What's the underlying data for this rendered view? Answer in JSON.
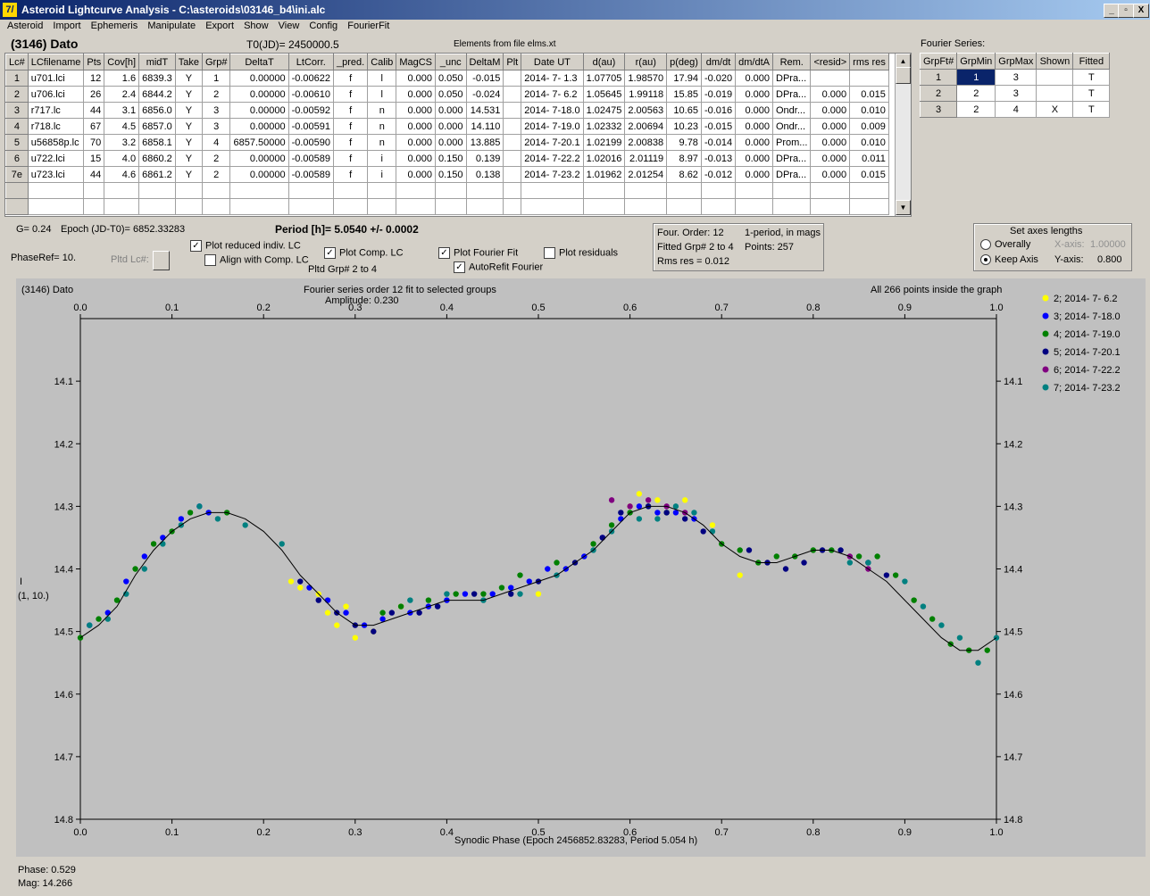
{
  "window": {
    "title": "Asteroid Lightcurve Analysis - C:\\asteroids\\03146_b4\\ini.alc",
    "icon_label": "7/",
    "btn_minimize": "_",
    "btn_restore": "▫",
    "btn_close": "X"
  },
  "menu": [
    "Asteroid",
    "Import",
    "Ephemeris",
    "Manipulate",
    "Export",
    "Show",
    "View",
    "Config",
    "FourierFit"
  ],
  "header": {
    "asteroid": "(3146) Dato",
    "t0": "T0(JD)= 2450000.5",
    "elements": "Elements from file elms.xt"
  },
  "lc_table": {
    "columns": [
      "Lc#",
      "LCfilename",
      "Pts",
      "Cov[h]",
      "midT",
      "Take",
      "Grp#",
      "DeltaT",
      "LtCorr.",
      "_pred.",
      "Calib",
      "MagCS",
      "_unc",
      "DeltaM",
      "Plt",
      "Date UT",
      "d(au)",
      "r(au)",
      "p(deg)",
      "dm/dt",
      "dm/dtA",
      "Rem.",
      "<resid>",
      "rms res"
    ],
    "rows": [
      [
        "1",
        "u701.lci",
        "12",
        "1.6",
        "6839.3",
        "Y",
        "1",
        "0.00000",
        "-0.00622",
        "f",
        "l",
        "0.000",
        "0.050",
        "-0.015",
        "",
        "2014- 7- 1.3",
        "1.07705",
        "1.98570",
        "17.94",
        "-0.020",
        "0.000",
        "DPra...",
        "",
        ""
      ],
      [
        "2",
        "u706.lci",
        "26",
        "2.4",
        "6844.2",
        "Y",
        "2",
        "0.00000",
        "-0.00610",
        "f",
        "l",
        "0.000",
        "0.050",
        "-0.024",
        "",
        "2014- 7- 6.2",
        "1.05645",
        "1.99118",
        "15.85",
        "-0.019",
        "0.000",
        "DPra...",
        "0.000",
        "0.015"
      ],
      [
        "3",
        "r717.lc",
        "44",
        "3.1",
        "6856.0",
        "Y",
        "3",
        "0.00000",
        "-0.00592",
        "f",
        "n",
        "0.000",
        "0.000",
        "14.531",
        "",
        "2014- 7-18.0",
        "1.02475",
        "2.00563",
        "10.65",
        "-0.016",
        "0.000",
        "Ondr...",
        "0.000",
        "0.010"
      ],
      [
        "4",
        "r718.lc",
        "67",
        "4.5",
        "6857.0",
        "Y",
        "3",
        "0.00000",
        "-0.00591",
        "f",
        "n",
        "0.000",
        "0.000",
        "14.110",
        "",
        "2014- 7-19.0",
        "1.02332",
        "2.00694",
        "10.23",
        "-0.015",
        "0.000",
        "Ondr...",
        "0.000",
        "0.009"
      ],
      [
        "5",
        "u56858p.lc",
        "70",
        "3.2",
        "6858.1",
        "Y",
        "4",
        "6857.50000",
        "-0.00590",
        "f",
        "n",
        "0.000",
        "0.000",
        "13.885",
        "",
        "2014- 7-20.1",
        "1.02199",
        "2.00838",
        "9.78",
        "-0.014",
        "0.000",
        "Prom...",
        "0.000",
        "0.010"
      ],
      [
        "6",
        "u722.lci",
        "15",
        "4.0",
        "6860.2",
        "Y",
        "2",
        "0.00000",
        "-0.00589",
        "f",
        "i",
        "0.000",
        "0.150",
        "0.139",
        "",
        "2014- 7-22.2",
        "1.02016",
        "2.01119",
        "8.97",
        "-0.013",
        "0.000",
        "DPra...",
        "0.000",
        "0.011"
      ],
      [
        "7e",
        "u723.lci",
        "44",
        "4.6",
        "6861.2",
        "Y",
        "2",
        "0.00000",
        "-0.00589",
        "f",
        "i",
        "0.000",
        "0.150",
        "0.138",
        "",
        "2014- 7-23.2",
        "1.01962",
        "2.01254",
        "8.62",
        "-0.012",
        "0.000",
        "DPra...",
        "0.000",
        "0.015"
      ]
    ]
  },
  "fourier_table": {
    "title": "Fourier Series:",
    "columns": [
      "GrpFt#",
      "GrpMin",
      "GrpMax",
      "Shown",
      "Fitted"
    ],
    "rows": [
      [
        "1",
        "1",
        "3",
        "",
        "T"
      ],
      [
        "2",
        "2",
        "3",
        "",
        "T"
      ],
      [
        "3",
        "2",
        "4",
        "X",
        "T"
      ]
    ]
  },
  "controls": {
    "g": "G= 0.24",
    "epoch": "Epoch (JD-T0)= 6852.33283",
    "period": "Period [h]= 5.0540 +/- 0.0002",
    "phaseref": "PhaseRef= 10.",
    "pltd_lc": "Pltd Lc#:",
    "plot_reduced": "Plot reduced indiv. LC",
    "align_comp": "Align with Comp. LC",
    "plot_comp": "Plot Comp. LC",
    "pltd_grp": "Pltd Grp#  2  to   4",
    "plot_fourier": "Plot Fourier Fit",
    "autorefit": "AutoRefit Fourier",
    "plot_residuals": "Plot residuals",
    "check_mark": "✓"
  },
  "fit_info": {
    "order": "Four. Order: 12",
    "mode": "1-period, in mags",
    "fitted": "Fitted Grp# 2 to 4",
    "points": "Points: 257",
    "rms": "Rms res     = 0.012"
  },
  "axes_box": {
    "title": "Set axes lengths",
    "overally": "Overally",
    "keep": "Keep Axis",
    "xaxis_label": "X-axis:",
    "xaxis_val": "1.00000",
    "yaxis_label": "Y-axis:",
    "yaxis_val": "0.800"
  },
  "plot": {
    "left_title": "(3146) Dato",
    "center_title": "Fourier series order 12 fit to selected groups",
    "amplitude": "Amplitude: 0.230",
    "right_title": "All 266 points inside the graph",
    "ylabel": "I",
    "ylabel2": "(1, 10.)",
    "xlabel": "Synodic Phase (Epoch 2456852.83283, Period 5.054 h)"
  },
  "chart_data": {
    "type": "scatter",
    "xlim": [
      0.0,
      1.0
    ],
    "ylim": [
      14.8,
      14.0
    ],
    "xticks": [
      "0.0",
      "0.1",
      "0.2",
      "0.3",
      "0.4",
      "0.5",
      "0.6",
      "0.7",
      "0.8",
      "0.9",
      "1.0"
    ],
    "yticks": [
      "14.1",
      "14.2",
      "14.3",
      "14.4",
      "14.5",
      "14.6",
      "14.7",
      "14.8"
    ],
    "grid": false,
    "legend_position": "right",
    "series": [
      {
        "name": "2; 2014- 7- 6.2",
        "color": "#ffff00",
        "points": [
          [
            0.23,
            14.42
          ],
          [
            0.24,
            14.43
          ],
          [
            0.26,
            14.44
          ],
          [
            0.27,
            14.47
          ],
          [
            0.28,
            14.49
          ],
          [
            0.29,
            14.46
          ],
          [
            0.3,
            14.51
          ],
          [
            0.32,
            14.5
          ],
          [
            0.33,
            14.48
          ],
          [
            0.35,
            14.46
          ],
          [
            0.5,
            14.44
          ],
          [
            0.6,
            14.3
          ],
          [
            0.61,
            14.28
          ],
          [
            0.63,
            14.29
          ],
          [
            0.66,
            14.29
          ],
          [
            0.69,
            14.33
          ],
          [
            0.72,
            14.41
          ]
        ]
      },
      {
        "name": "3; 2014- 7-18.0",
        "color": "#0000ff",
        "points": [
          [
            0.01,
            14.49
          ],
          [
            0.03,
            14.47
          ],
          [
            0.05,
            14.42
          ],
          [
            0.07,
            14.38
          ],
          [
            0.09,
            14.35
          ],
          [
            0.11,
            14.32
          ],
          [
            0.13,
            14.3
          ],
          [
            0.14,
            14.31
          ],
          [
            0.25,
            14.43
          ],
          [
            0.27,
            14.45
          ],
          [
            0.29,
            14.47
          ],
          [
            0.31,
            14.49
          ],
          [
            0.33,
            14.48
          ],
          [
            0.36,
            14.47
          ],
          [
            0.38,
            14.46
          ],
          [
            0.4,
            14.45
          ],
          [
            0.42,
            14.44
          ],
          [
            0.45,
            14.44
          ],
          [
            0.47,
            14.43
          ],
          [
            0.49,
            14.42
          ],
          [
            0.51,
            14.4
          ],
          [
            0.53,
            14.4
          ],
          [
            0.55,
            14.38
          ],
          [
            0.57,
            14.35
          ],
          [
            0.59,
            14.32
          ],
          [
            0.61,
            14.3
          ],
          [
            0.63,
            14.31
          ],
          [
            0.65,
            14.31
          ],
          [
            0.67,
            14.32
          ]
        ]
      },
      {
        "name": "4; 2014- 7-19.0",
        "color": "#008000",
        "points": [
          [
            0.0,
            14.51
          ],
          [
            0.02,
            14.48
          ],
          [
            0.04,
            14.45
          ],
          [
            0.06,
            14.4
          ],
          [
            0.08,
            14.36
          ],
          [
            0.1,
            14.34
          ],
          [
            0.12,
            14.31
          ],
          [
            0.16,
            14.31
          ],
          [
            0.33,
            14.47
          ],
          [
            0.35,
            14.46
          ],
          [
            0.38,
            14.45
          ],
          [
            0.41,
            14.44
          ],
          [
            0.44,
            14.44
          ],
          [
            0.46,
            14.43
          ],
          [
            0.48,
            14.41
          ],
          [
            0.52,
            14.39
          ],
          [
            0.56,
            14.36
          ],
          [
            0.58,
            14.33
          ],
          [
            0.6,
            14.31
          ],
          [
            0.62,
            14.3
          ],
          [
            0.64,
            14.31
          ],
          [
            0.7,
            14.36
          ],
          [
            0.72,
            14.37
          ],
          [
            0.74,
            14.39
          ],
          [
            0.76,
            14.38
          ],
          [
            0.78,
            14.38
          ],
          [
            0.8,
            14.37
          ],
          [
            0.82,
            14.37
          ],
          [
            0.85,
            14.38
          ],
          [
            0.87,
            14.38
          ],
          [
            0.89,
            14.41
          ],
          [
            0.91,
            14.45
          ],
          [
            0.93,
            14.48
          ],
          [
            0.95,
            14.52
          ],
          [
            0.97,
            14.53
          ],
          [
            0.99,
            14.53
          ]
        ]
      },
      {
        "name": "5; 2014- 7-20.1",
        "color": "#000080",
        "points": [
          [
            0.24,
            14.42
          ],
          [
            0.26,
            14.45
          ],
          [
            0.28,
            14.47
          ],
          [
            0.3,
            14.49
          ],
          [
            0.32,
            14.5
          ],
          [
            0.34,
            14.47
          ],
          [
            0.37,
            14.47
          ],
          [
            0.39,
            14.46
          ],
          [
            0.43,
            14.44
          ],
          [
            0.47,
            14.44
          ],
          [
            0.5,
            14.42
          ],
          [
            0.54,
            14.39
          ],
          [
            0.57,
            14.35
          ],
          [
            0.59,
            14.31
          ],
          [
            0.62,
            14.3
          ],
          [
            0.64,
            14.31
          ],
          [
            0.66,
            14.32
          ],
          [
            0.68,
            14.34
          ],
          [
            0.73,
            14.37
          ],
          [
            0.75,
            14.39
          ],
          [
            0.77,
            14.4
          ],
          [
            0.79,
            14.39
          ],
          [
            0.81,
            14.37
          ],
          [
            0.83,
            14.37
          ],
          [
            0.86,
            14.39
          ],
          [
            0.88,
            14.41
          ]
        ]
      },
      {
        "name": "6; 2014- 7-22.2",
        "color": "#800080",
        "points": [
          [
            0.58,
            14.29
          ],
          [
            0.6,
            14.3
          ],
          [
            0.62,
            14.29
          ],
          [
            0.64,
            14.3
          ],
          [
            0.66,
            14.31
          ],
          [
            0.84,
            14.38
          ],
          [
            0.86,
            14.4
          ]
        ]
      },
      {
        "name": "7; 2014- 7-23.2",
        "color": "#008080",
        "points": [
          [
            0.01,
            14.49
          ],
          [
            0.03,
            14.48
          ],
          [
            0.05,
            14.44
          ],
          [
            0.07,
            14.4
          ],
          [
            0.09,
            14.36
          ],
          [
            0.11,
            14.33
          ],
          [
            0.13,
            14.3
          ],
          [
            0.15,
            14.32
          ],
          [
            0.18,
            14.33
          ],
          [
            0.22,
            14.36
          ],
          [
            0.36,
            14.45
          ],
          [
            0.4,
            14.44
          ],
          [
            0.44,
            14.45
          ],
          [
            0.48,
            14.44
          ],
          [
            0.52,
            14.41
          ],
          [
            0.56,
            14.37
          ],
          [
            0.58,
            14.34
          ],
          [
            0.61,
            14.32
          ],
          [
            0.63,
            14.32
          ],
          [
            0.65,
            14.3
          ],
          [
            0.67,
            14.31
          ],
          [
            0.69,
            14.34
          ],
          [
            0.84,
            14.39
          ],
          [
            0.86,
            14.39
          ],
          [
            0.9,
            14.42
          ],
          [
            0.92,
            14.46
          ],
          [
            0.94,
            14.49
          ],
          [
            0.96,
            14.51
          ],
          [
            0.98,
            14.55
          ],
          [
            1.0,
            14.51
          ]
        ]
      }
    ],
    "fit_curve": [
      [
        0.0,
        14.51
      ],
      [
        0.02,
        14.49
      ],
      [
        0.04,
        14.46
      ],
      [
        0.06,
        14.41
      ],
      [
        0.08,
        14.37
      ],
      [
        0.1,
        14.34
      ],
      [
        0.12,
        14.32
      ],
      [
        0.14,
        14.31
      ],
      [
        0.16,
        14.31
      ],
      [
        0.18,
        14.32
      ],
      [
        0.2,
        14.34
      ],
      [
        0.22,
        14.37
      ],
      [
        0.24,
        14.41
      ],
      [
        0.26,
        14.44
      ],
      [
        0.28,
        14.47
      ],
      [
        0.3,
        14.49
      ],
      [
        0.32,
        14.49
      ],
      [
        0.34,
        14.48
      ],
      [
        0.36,
        14.47
      ],
      [
        0.38,
        14.46
      ],
      [
        0.4,
        14.45
      ],
      [
        0.42,
        14.45
      ],
      [
        0.44,
        14.45
      ],
      [
        0.46,
        14.44
      ],
      [
        0.48,
        14.43
      ],
      [
        0.5,
        14.42
      ],
      [
        0.52,
        14.41
      ],
      [
        0.54,
        14.39
      ],
      [
        0.56,
        14.37
      ],
      [
        0.58,
        14.34
      ],
      [
        0.6,
        14.31
      ],
      [
        0.62,
        14.3
      ],
      [
        0.64,
        14.3
      ],
      [
        0.66,
        14.31
      ],
      [
        0.68,
        14.33
      ],
      [
        0.7,
        14.36
      ],
      [
        0.72,
        14.38
      ],
      [
        0.74,
        14.39
      ],
      [
        0.76,
        14.39
      ],
      [
        0.78,
        14.38
      ],
      [
        0.8,
        14.37
      ],
      [
        0.82,
        14.37
      ],
      [
        0.84,
        14.38
      ],
      [
        0.86,
        14.4
      ],
      [
        0.88,
        14.42
      ],
      [
        0.9,
        14.45
      ],
      [
        0.92,
        14.48
      ],
      [
        0.94,
        14.51
      ],
      [
        0.96,
        14.53
      ],
      [
        0.98,
        14.53
      ],
      [
        1.0,
        14.51
      ]
    ]
  },
  "status": {
    "phase": "Phase:  0.529",
    "mag": "Mag:    14.266"
  }
}
